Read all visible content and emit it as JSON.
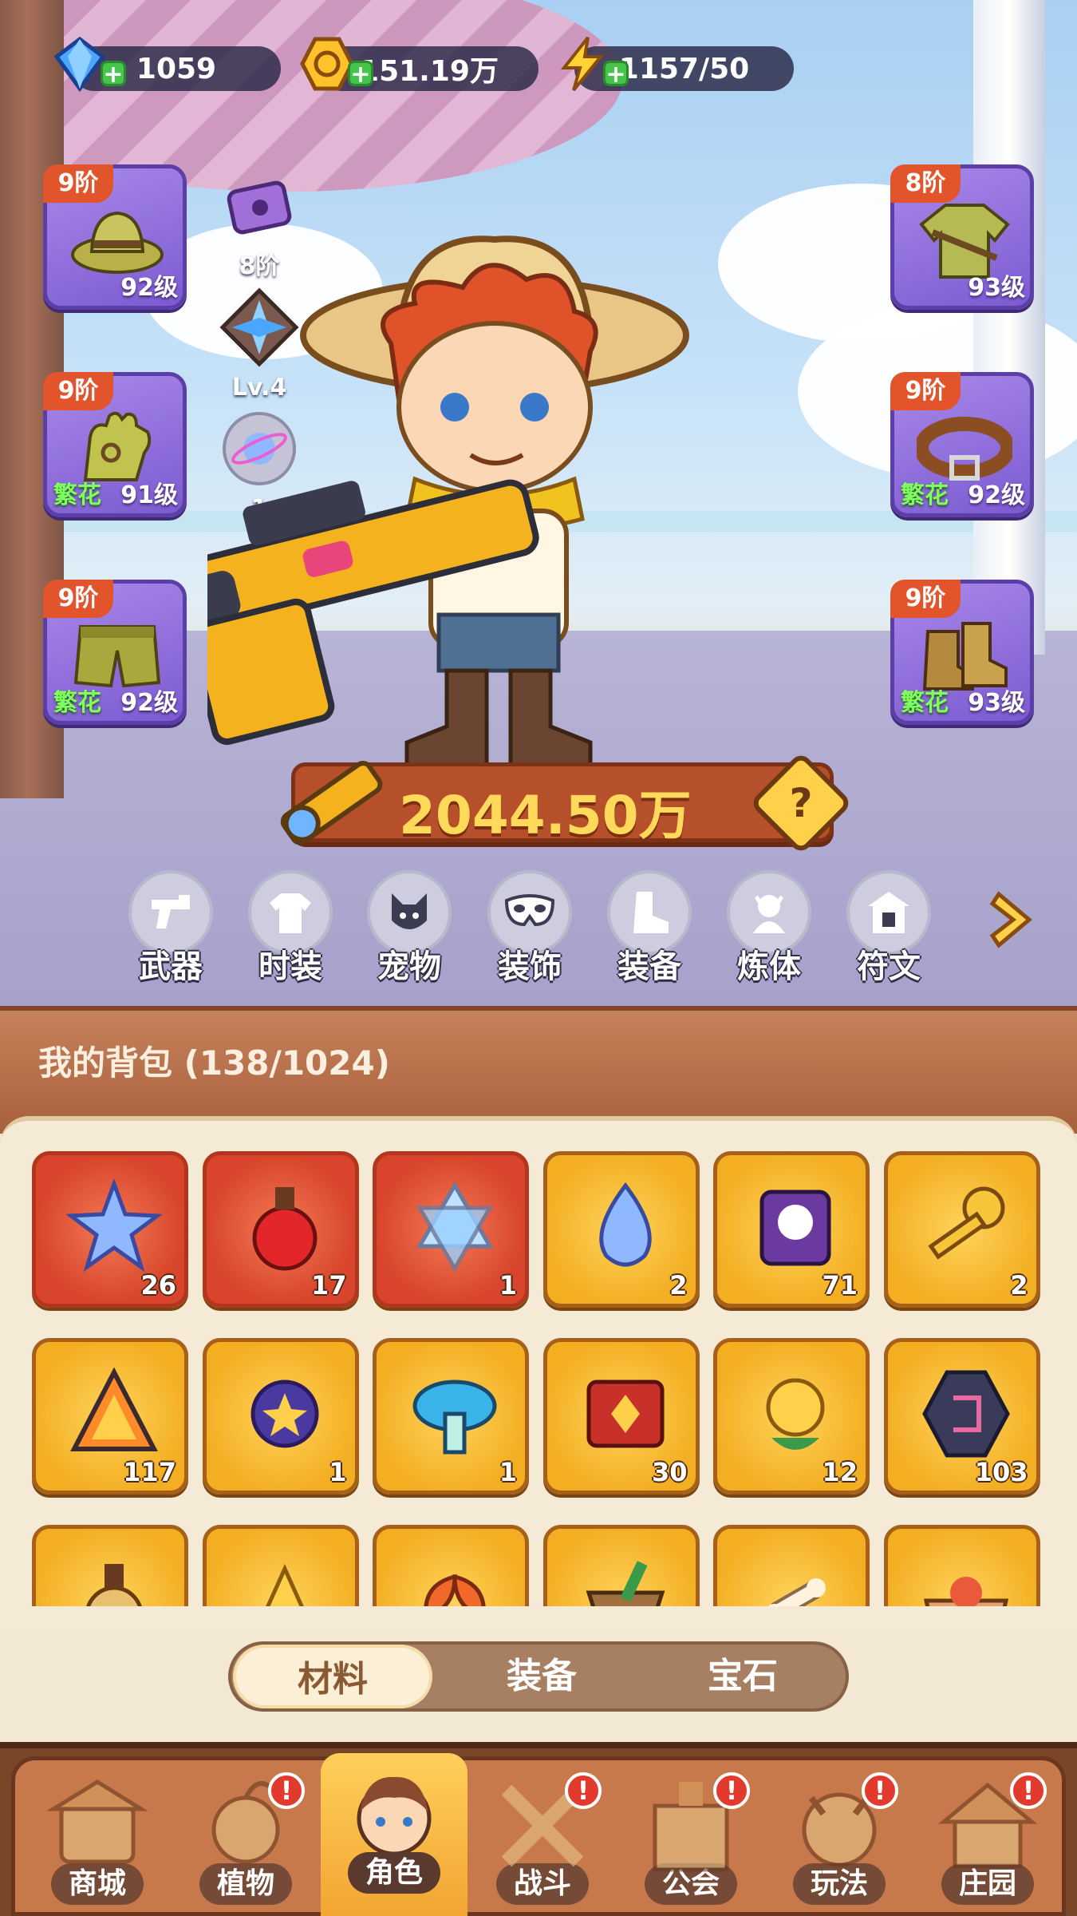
{
  "resources": {
    "gems": "1059",
    "gold": "151.19万",
    "energy": "1157/50"
  },
  "equipment": {
    "hat": {
      "tier": "9阶",
      "level": "92级",
      "tag": ""
    },
    "gloves": {
      "tier": "9阶",
      "level": "91级",
      "tag": "繁花"
    },
    "pants": {
      "tier": "9阶",
      "level": "92级",
      "tag": "繁花"
    },
    "clothes": {
      "tier": "8阶",
      "level": "93级",
      "tag": ""
    },
    "belt": {
      "tier": "9阶",
      "level": "92级",
      "tag": "繁花"
    },
    "boots": {
      "tier": "9阶",
      "level": "93级",
      "tag": "繁花"
    }
  },
  "mini_badges": {
    "case": "8阶",
    "star": "Lv.4",
    "orb": "1"
  },
  "power": "2044.50万",
  "power_help": "?",
  "categories": [
    "武器",
    "时装",
    "宠物",
    "装饰",
    "装备",
    "炼体",
    "符文"
  ],
  "bag": {
    "title": "我的背包 (138/1024)",
    "items": [
      {
        "icon": "crystal-star-icon",
        "count": "26",
        "rarity": "red"
      },
      {
        "icon": "apple-potion-icon",
        "count": "17",
        "rarity": "red"
      },
      {
        "icon": "hexagram-crystal-icon",
        "count": "1",
        "rarity": "red"
      },
      {
        "icon": "water-drop-icon",
        "count": "2",
        "rarity": "gold"
      },
      {
        "icon": "skull-scroll-icon",
        "count": "71",
        "rarity": "gold"
      },
      {
        "icon": "golden-key-icon",
        "count": "2",
        "rarity": "gold"
      },
      {
        "icon": "fire-prism-icon",
        "count": "117",
        "rarity": "gold"
      },
      {
        "icon": "star-orb-icon",
        "count": "1",
        "rarity": "gold"
      },
      {
        "icon": "blue-mushroom-icon",
        "count": "1",
        "rarity": "gold"
      },
      {
        "icon": "red-book-icon",
        "count": "30",
        "rarity": "gold"
      },
      {
        "icon": "golden-flower-icon",
        "count": "12",
        "rarity": "gold"
      },
      {
        "icon": "rune-stone-icon",
        "count": "103",
        "rarity": "gold"
      },
      {
        "icon": "potion-bottle-icon",
        "count": "",
        "rarity": "gold"
      },
      {
        "icon": "crystal-pile-icon",
        "count": "",
        "rarity": "gold"
      },
      {
        "icon": "lily-flower-icon",
        "count": "",
        "rarity": "gold"
      },
      {
        "icon": "mortar-icon",
        "count": "",
        "rarity": "gold"
      },
      {
        "icon": "bone-icon",
        "count": "",
        "rarity": "gold"
      },
      {
        "icon": "food-bowl-icon",
        "count": "",
        "rarity": "gold"
      }
    ]
  },
  "tabs": [
    "材料",
    "装备",
    "宝石"
  ],
  "nav": [
    {
      "label": "商城",
      "badge": ""
    },
    {
      "label": "植物",
      "badge": "!"
    },
    {
      "label": "角色",
      "badge": ""
    },
    {
      "label": "战斗",
      "badge": "!"
    },
    {
      "label": "公会",
      "badge": "!"
    },
    {
      "label": "玩法",
      "badge": "!"
    },
    {
      "label": "庄园",
      "badge": "!"
    }
  ],
  "colors": {
    "slot_purple": "#7c5bd2",
    "tier_red": "#e2552c",
    "power_gold": "#ffd95a",
    "item_gold": "#f3ae22",
    "item_red": "#d8452c",
    "nav_active": "#ffcf5a",
    "badge_red": "#e23b2d"
  }
}
